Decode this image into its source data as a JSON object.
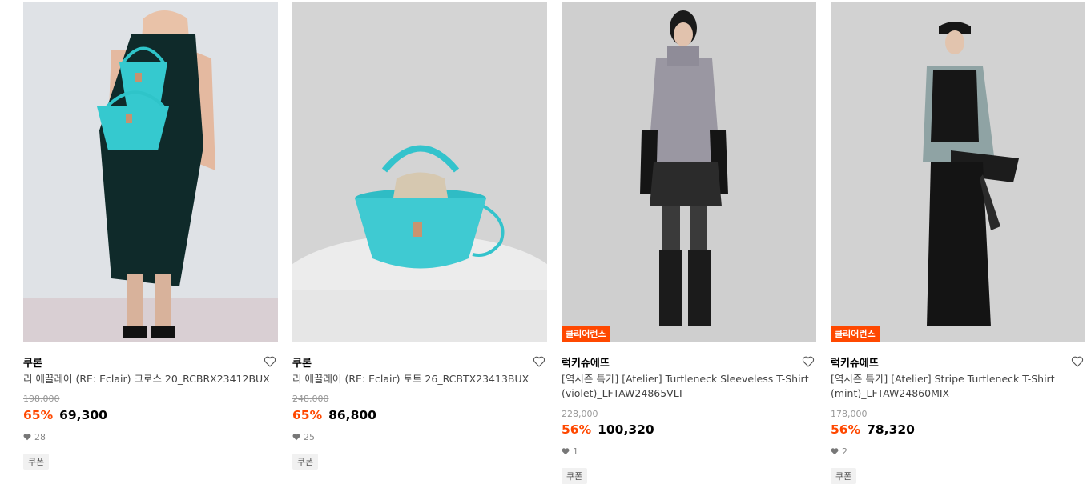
{
  "products": [
    {
      "badge": "",
      "brand": "쿠론",
      "name": "리 에끌레어 (RE: Eclair) 크로스 20_RCBRX23412BUX",
      "original_price": "198,000",
      "discount": "65%",
      "price": "69,300",
      "likes": "28",
      "coupon": "쿠폰"
    },
    {
      "badge": "",
      "brand": "쿠론",
      "name": "리 에끌레어 (RE: Eclair) 토트 26_RCBTX23413BUX",
      "original_price": "248,000",
      "discount": "65%",
      "price": "86,800",
      "likes": "25",
      "coupon": "쿠폰"
    },
    {
      "badge": "클리어런스",
      "brand": "럭키슈에뜨",
      "name": "[역시즌 특가] [Atelier] Turtleneck Sleeveless T-Shirt (violet)_LFTAW24865VLT",
      "original_price": "228,000",
      "discount": "56%",
      "price": "100,320",
      "likes": "1",
      "coupon": "쿠폰"
    },
    {
      "badge": "클리어런스",
      "brand": "럭키슈에뜨",
      "name": "[역시즌 특가] [Atelier] Stripe Turtleneck T-Shirt (mint)_LFTAW24860MIX",
      "original_price": "178,000",
      "discount": "56%",
      "price": "78,320",
      "likes": "2",
      "coupon": "쿠폰"
    }
  ],
  "colors": {
    "accent": "#ff4800",
    "muted": "#999999",
    "teal_bag": "#35c9cf"
  }
}
